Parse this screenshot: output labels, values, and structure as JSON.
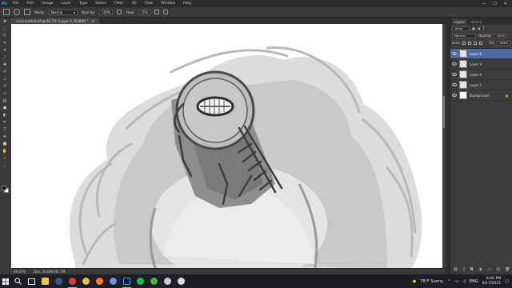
{
  "app": {
    "logo": "Ps",
    "menu": [
      "File",
      "Edit",
      "Image",
      "Layer",
      "Type",
      "Select",
      "Filter",
      "3D",
      "View",
      "Window",
      "Help"
    ],
    "window_controls": [
      "—",
      "☐",
      "✕"
    ]
  },
  "options": {
    "mode_label": "Mode:",
    "mode_value": "Normal",
    "opacity_label": "Opacity:",
    "opacity_value": "100%",
    "flow_label": "Flow:",
    "flow_value": "35%"
  },
  "document": {
    "tab_title": "clicknestbrd.tif @ 66.7% (Layer 6, RGB/8) *",
    "zoom": "66.67%",
    "doc_info": "Doc: 44.6M/191.7M"
  },
  "layers_panel": {
    "tabs": [
      "Layers",
      "History"
    ],
    "kind_label": "Kind",
    "blend_mode": "Normal",
    "opacity_label": "Opacity:",
    "opacity_value": "100%",
    "lock_label": "Lock:",
    "fill_label": "Fill:",
    "fill_value": "100%",
    "layers": [
      {
        "name": "Layer 6",
        "selected": true
      },
      {
        "name": "Layer 3",
        "selected": false
      },
      {
        "name": "Layer 4",
        "selected": false
      },
      {
        "name": "Layer 2",
        "selected": false
      },
      {
        "name": "Background",
        "selected": false
      }
    ]
  },
  "taskbar": {
    "weather": "78°F  Sunny",
    "lang": "ENG",
    "time": "8:40 PM",
    "date": "6/17/2021",
    "apps": [
      {
        "name": "search",
        "color": "#ffffff"
      },
      {
        "name": "task-view",
        "color": "#ffffff"
      },
      {
        "name": "file-explorer",
        "color": "#f3c343"
      },
      {
        "name": "steam",
        "color": "#2a5f8f"
      },
      {
        "name": "opera",
        "color": "#e23b3b"
      },
      {
        "name": "app-yellow",
        "color": "#e9c23d"
      },
      {
        "name": "firefox",
        "color": "#ff7a1a"
      },
      {
        "name": "discord",
        "color": "#7289da"
      },
      {
        "name": "photoshop",
        "color": "#31a8ff"
      },
      {
        "name": "spotify",
        "color": "#1db954"
      },
      {
        "name": "chrome",
        "color": "#4caf50"
      },
      {
        "name": "music",
        "color": "#cccccc"
      },
      {
        "name": "obs",
        "color": "#dddddd"
      }
    ]
  },
  "colors": {
    "accent_selected_layer": "#4d6aa0",
    "ps_blue": "#31a8ff"
  }
}
